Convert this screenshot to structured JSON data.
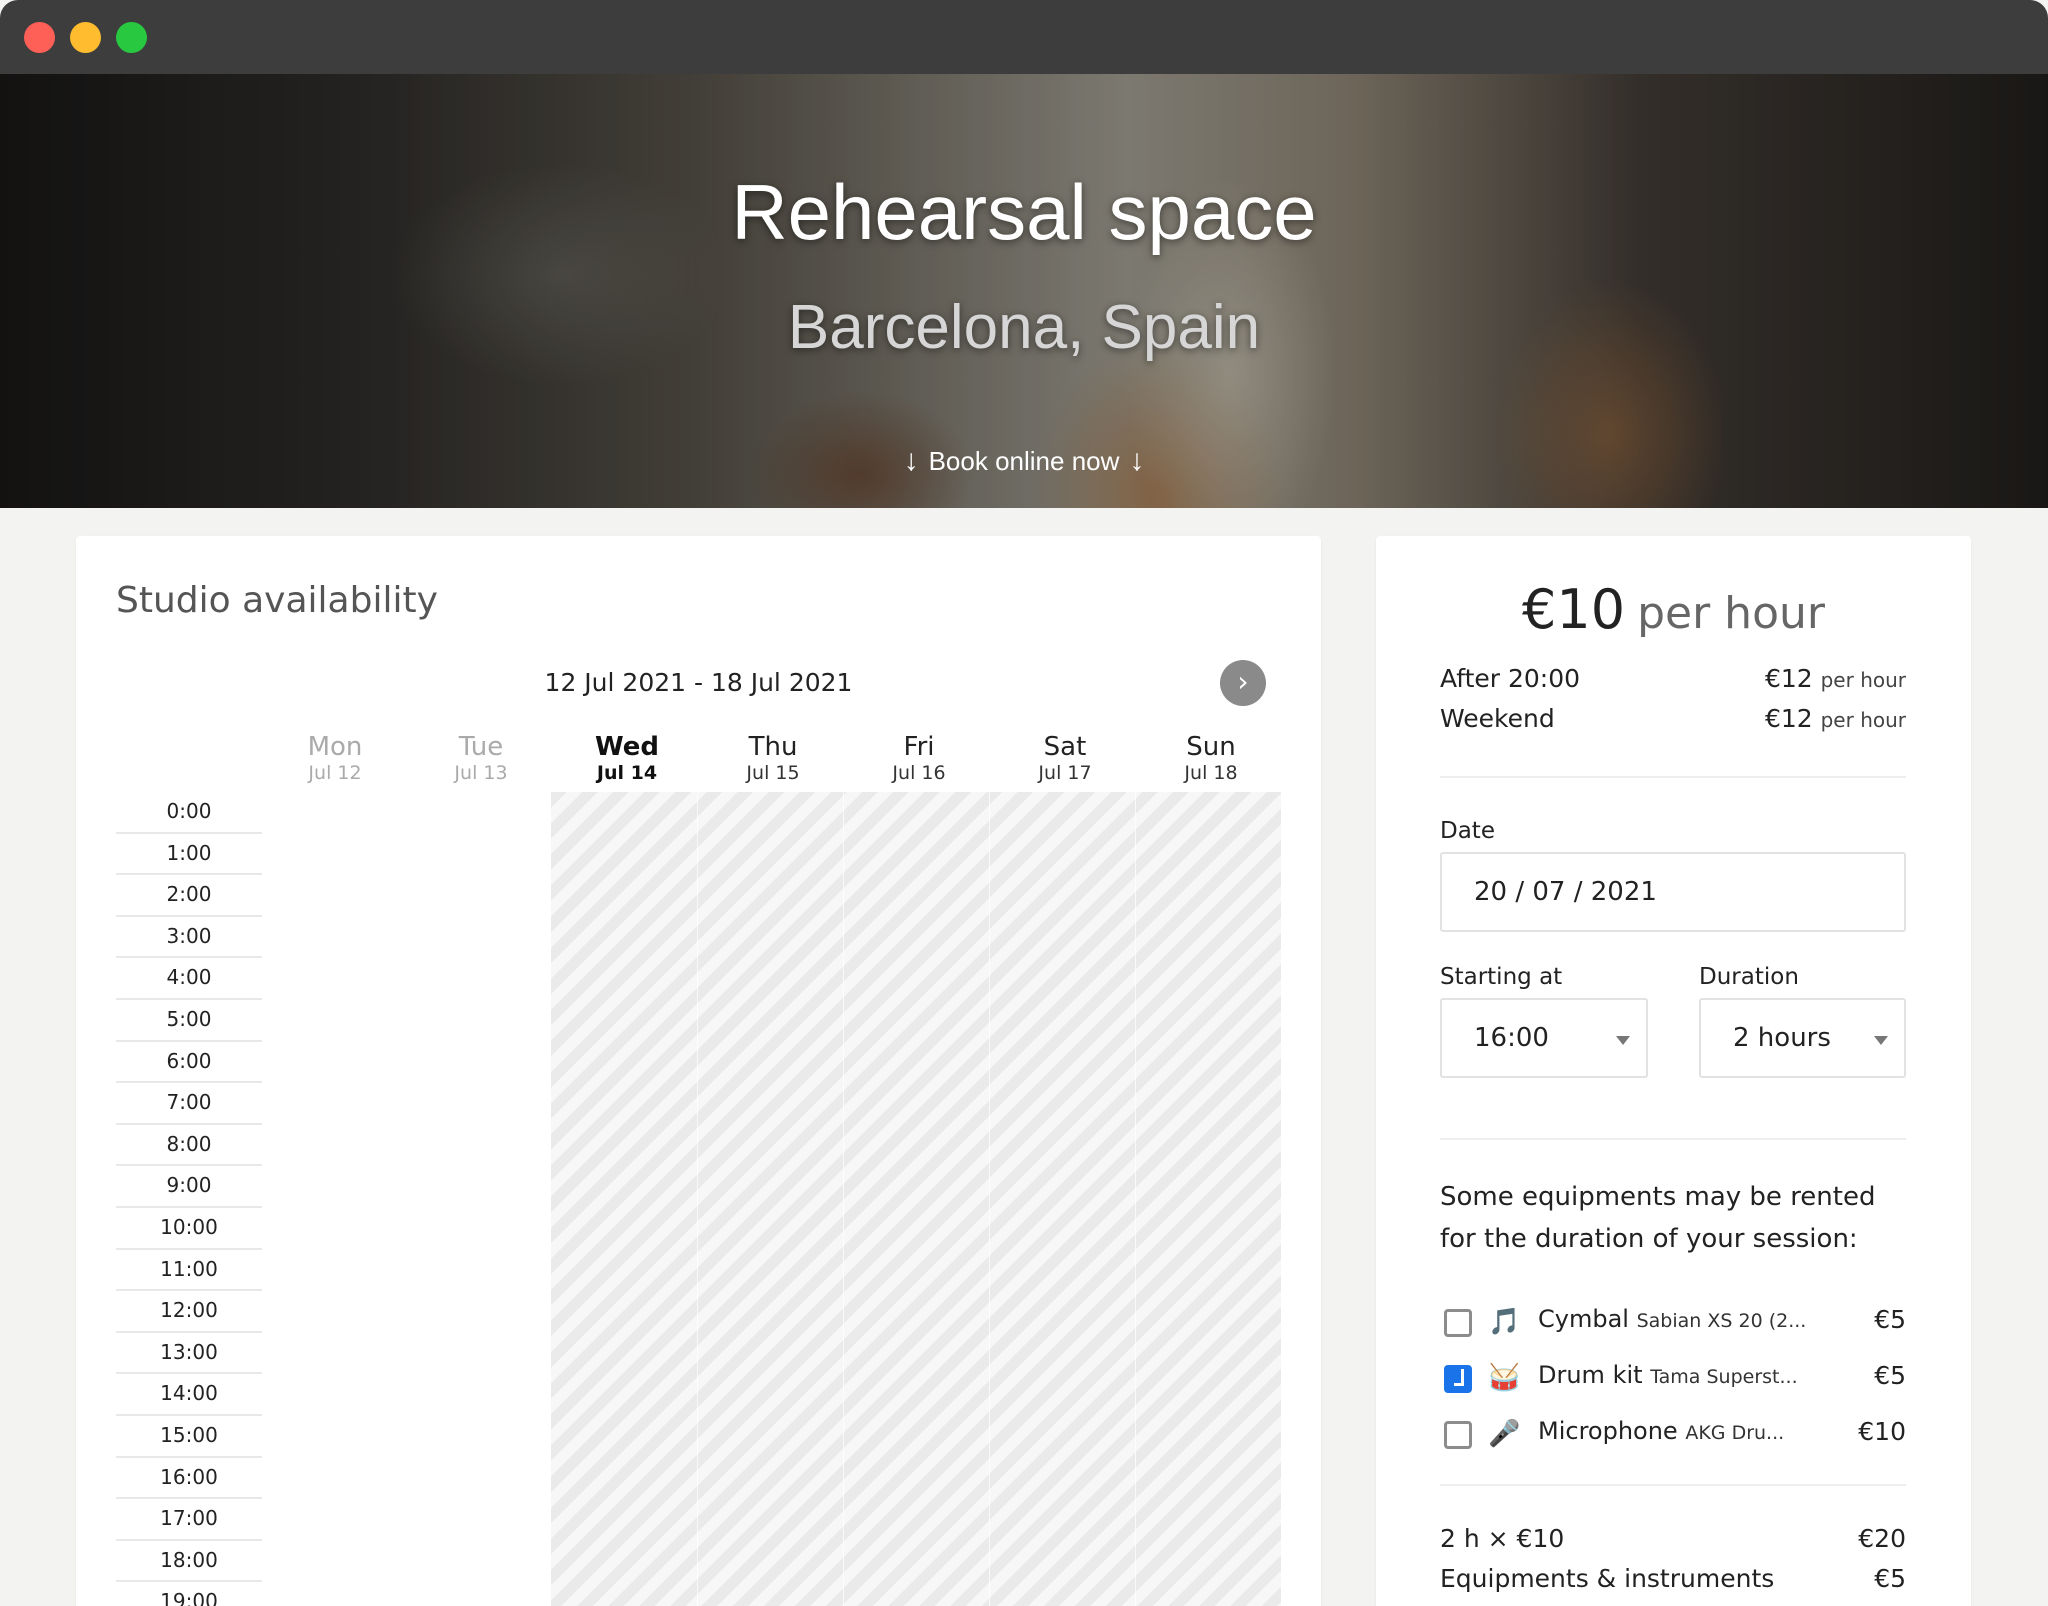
{
  "hero": {
    "title": "Rehearsal space",
    "subtitle": "Barcelona, Spain",
    "cta_label": "Book online now",
    "arrow": "↓"
  },
  "calendar": {
    "title": "Studio availability",
    "range": "12 Jul 2021 - 18 Jul 2021",
    "next_icon": "chevron-right-icon",
    "next_glyph": "›",
    "days": [
      {
        "name": "Mon",
        "date": "Jul 12",
        "state": "past"
      },
      {
        "name": "Tue",
        "date": "Jul 13",
        "state": "past"
      },
      {
        "name": "Wed",
        "date": "Jul 14",
        "state": "today"
      },
      {
        "name": "Thu",
        "date": "Jul 15",
        "state": "normal"
      },
      {
        "name": "Fri",
        "date": "Jul 16",
        "state": "normal"
      },
      {
        "name": "Sat",
        "date": "Jul 17",
        "state": "normal"
      },
      {
        "name": "Sun",
        "date": "Jul 18",
        "state": "normal"
      }
    ],
    "hours": [
      "0:00",
      "1:00",
      "2:00",
      "3:00",
      "4:00",
      "5:00",
      "6:00",
      "7:00",
      "8:00",
      "9:00",
      "10:00",
      "11:00",
      "12:00",
      "13:00",
      "14:00",
      "15:00",
      "16:00",
      "17:00",
      "18:00",
      "19:00"
    ]
  },
  "booking": {
    "price_amount": "€10",
    "price_unit": "per hour",
    "rates": [
      {
        "label": "After 20:00",
        "price": "€12",
        "unit": "per hour"
      },
      {
        "label": "Weekend",
        "price": "€12",
        "unit": "per hour"
      }
    ],
    "date_label": "Date",
    "date_value": "20 / 07 / 2021",
    "start_label": "Starting at",
    "start_value": "16:00",
    "duration_label": "Duration",
    "duration_value": "2 hours",
    "equipment_text": "Some equipments may be rented for the duration of your session:",
    "equipment": [
      {
        "name": "Cymbal",
        "detail": "Sabian XS 20 (2...",
        "price": "€5",
        "checked": false,
        "icon": "cymbal-icon",
        "glyph": "🎵"
      },
      {
        "name": "Drum kit",
        "detail": "Tama Superst...",
        "price": "€5",
        "checked": true,
        "icon": "drum-icon",
        "glyph": "🥁"
      },
      {
        "name": "Microphone",
        "detail": "AKG Dru...",
        "price": "€10",
        "checked": false,
        "icon": "microphone-icon",
        "glyph": "🎤"
      }
    ],
    "summary": [
      {
        "label": "2 h × €10",
        "value": "€20"
      },
      {
        "label": "Equipments & instruments",
        "value": "€5"
      }
    ]
  }
}
